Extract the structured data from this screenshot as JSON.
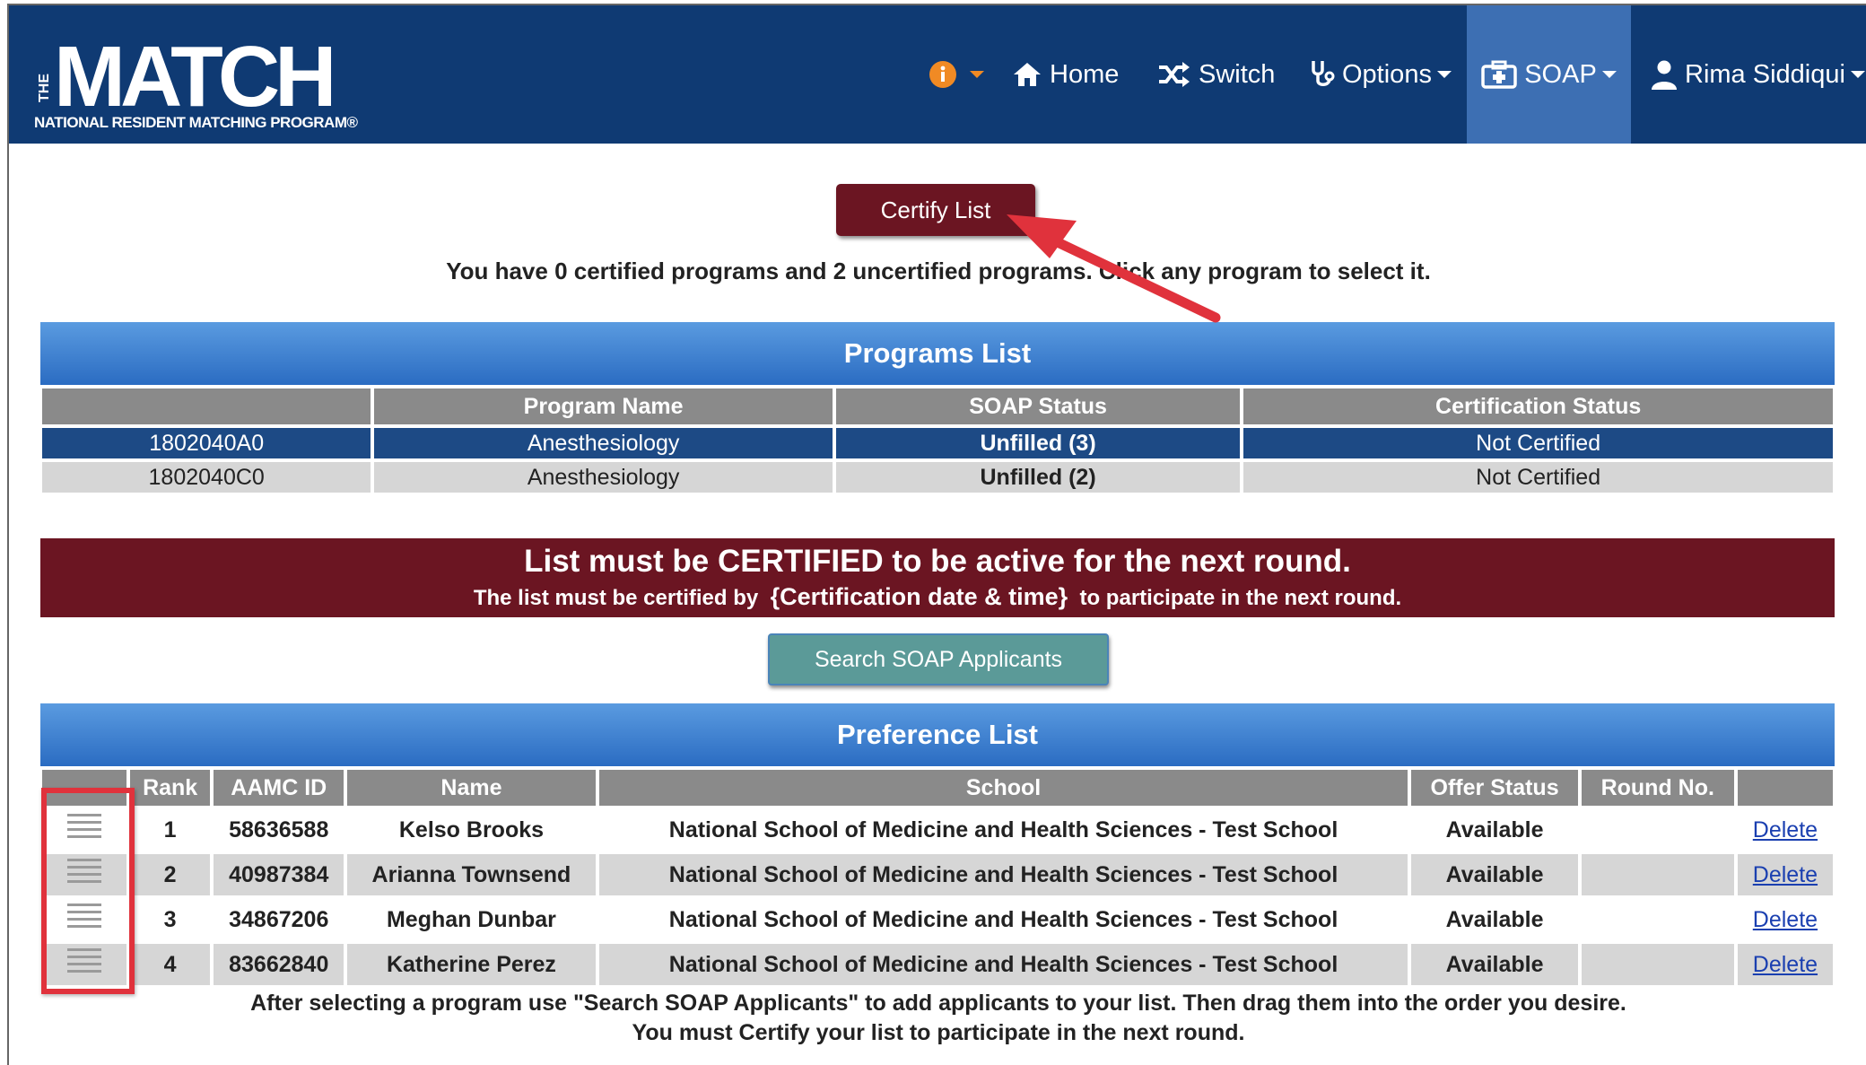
{
  "header": {
    "logo_text": "THE MATCH",
    "logo_subtitle": "NATIONAL RESIDENT MATCHING PROGRAM®",
    "nav": {
      "home": "Home",
      "switch": "Switch",
      "options": "Options",
      "soap": "SOAP",
      "user": "Rima Siddiqui"
    }
  },
  "certify_button": "Certify List",
  "cert_summary": "You have 0 certified programs and 2 uncertified programs. Click any program to select it.",
  "programs": {
    "title": "Programs List",
    "columns": [
      "",
      "Program Name",
      "SOAP Status",
      "Certification Status"
    ],
    "rows": [
      {
        "id": "1802040A0",
        "name": "Anesthesiology",
        "status": "Unfilled (3)",
        "cert": "Not Certified",
        "selected": true
      },
      {
        "id": "1802040C0",
        "name": "Anesthesiology",
        "status": "Unfilled (2)",
        "cert": "Not Certified",
        "selected": false
      }
    ]
  },
  "banner": {
    "headline": "List must be CERTIFIED to be active for the next round.",
    "pre": "The list must be certified by",
    "date": "{Certification date & time}",
    "post": "to participate in the next round."
  },
  "search_button": "Search SOAP Applicants",
  "preference": {
    "title": "Preference List",
    "columns": [
      "",
      "Rank",
      "AAMC ID",
      "Name",
      "School",
      "Offer Status",
      "Round No.",
      ""
    ],
    "rows": [
      {
        "rank": "1",
        "aamc": "58636588",
        "name": "Kelso Brooks",
        "school": "National School of Medicine and Health Sciences - Test School",
        "offer": "Available",
        "round": "",
        "action": "Delete"
      },
      {
        "rank": "2",
        "aamc": "40987384",
        "name": "Arianna Townsend",
        "school": "National School of Medicine and Health Sciences - Test School",
        "offer": "Available",
        "round": "",
        "action": "Delete"
      },
      {
        "rank": "3",
        "aamc": "34867206",
        "name": "Meghan Dunbar",
        "school": "National School of Medicine and Health Sciences - Test School",
        "offer": "Available",
        "round": "",
        "action": "Delete"
      },
      {
        "rank": "4",
        "aamc": "83662840",
        "name": "Katherine Perez",
        "school": "National School of Medicine and Health Sciences - Test School",
        "offer": "Available",
        "round": "",
        "action": "Delete"
      }
    ]
  },
  "footer": {
    "line1": "After selecting a program use \"Search SOAP Applicants\" to add applicants to your list. Then drag them into the order you desire.",
    "line2": "You must Certify your list to participate in the next round."
  },
  "colors": {
    "header_bg": "#0f3a73",
    "soap_active": "#3d6fb3",
    "maroon": "#6b1522",
    "unfilled_red": "#e00000",
    "annotation_red": "#e0323c"
  }
}
